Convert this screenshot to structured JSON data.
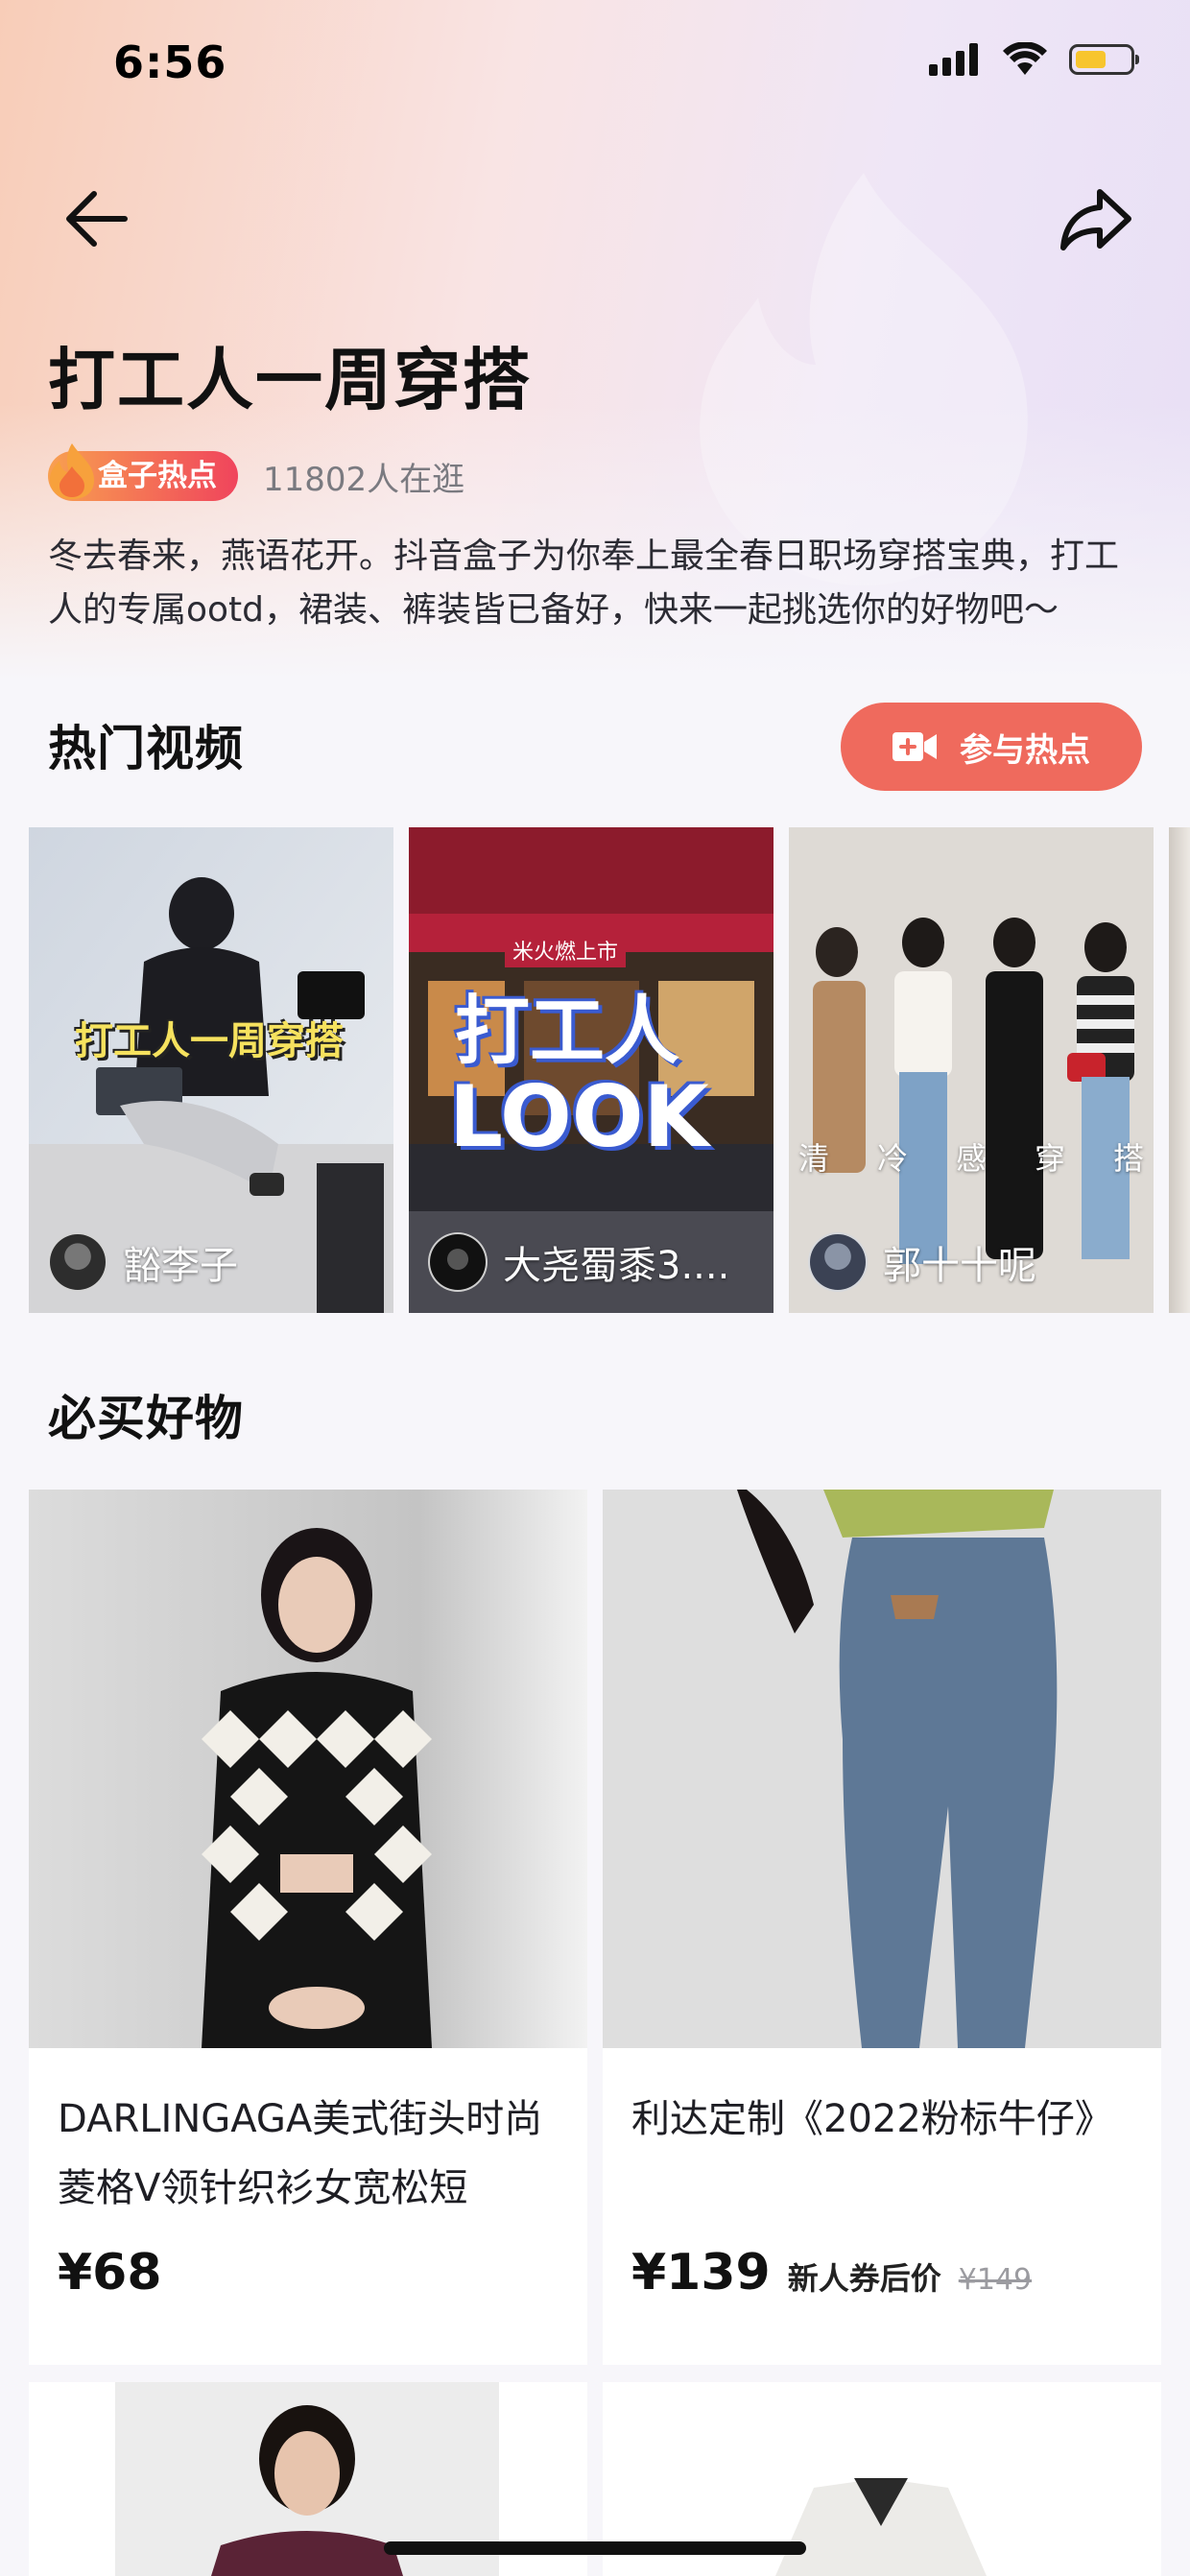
{
  "status_bar": {
    "time": "6:56",
    "battery_level": 0.55
  },
  "nav": {
    "back_icon": "arrow-left-icon",
    "share_icon": "share-icon"
  },
  "topic": {
    "title": "打工人一周穿搭",
    "badge": "盒子热点",
    "visitors": "11802人在逛",
    "description": "冬去春来，燕语花开。抖音盒子为你奉上最全春日职场穿搭宝典，打工人的专属ootd，裙装、裤装皆已备好，快来一起挑选你的好物吧～"
  },
  "hot_videos": {
    "section_title": "热门视频",
    "join_button": "参与热点",
    "videos": [
      {
        "author": "豁李子",
        "overlay_text": "打工人一周穿搭"
      },
      {
        "author": "大尧蜀黍3....",
        "overlay_text_1": "打工人",
        "overlay_text_2": "LOOK",
        "sign_text": "米火燃上市"
      },
      {
        "author": "郭十十呢",
        "overlay_chars": [
          "清",
          "冷",
          "感",
          "穿",
          "搭"
        ]
      }
    ]
  },
  "products": {
    "section_title": "必买好物",
    "items": [
      {
        "title": "DARLINGAGA美式街头时尚菱格V领针织衫女宽松短",
        "price": "¥68",
        "note": "",
        "old_price": ""
      },
      {
        "title": "利达定制《2022粉标牛仔》",
        "price": "¥139",
        "note": "新人券后价",
        "old_price": "¥149"
      }
    ]
  },
  "colors": {
    "accent": "#ef6a5d",
    "badge_start": "#f8a050",
    "badge_end": "#f0445c"
  }
}
